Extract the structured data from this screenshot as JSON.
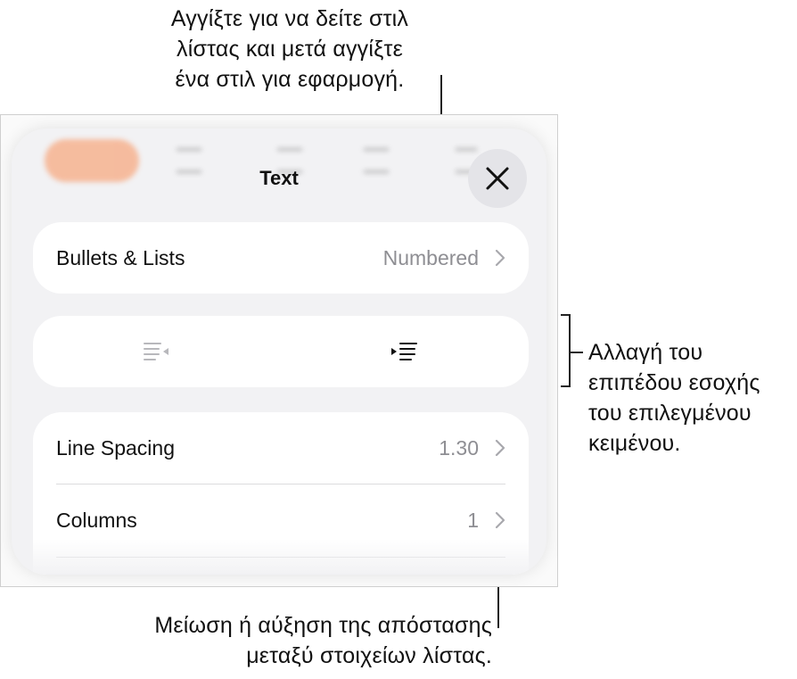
{
  "callouts": {
    "top": [
      "Αγγίξτε για να δείτε στιλ",
      "λίστας και μετά αγγίξτε",
      "ένα στιλ για εφαρμογή."
    ],
    "right": [
      "Αλλαγή του",
      "επιπέδου εσοχής",
      "του επιλεγμένου",
      "κειμένου."
    ],
    "bottom": [
      "Μείωση ή αύξηση της απόστασης",
      "μεταξύ στοιχείων λίστας."
    ]
  },
  "panel": {
    "title": "Text",
    "close_icon": "close-icon",
    "bullets": {
      "label": "Bullets & Lists",
      "value": "Numbered"
    },
    "indent": {
      "decrease_icon": "decrease-indent-icon",
      "increase_icon": "increase-indent-icon"
    },
    "line_spacing": {
      "label": "Line Spacing",
      "value": "1.30"
    },
    "columns": {
      "label": "Columns",
      "value": "1"
    }
  },
  "colors": {
    "accent": "#f7a57a",
    "secondary_text": "#8e8e93",
    "panel_bg": "#f2f2f4"
  }
}
